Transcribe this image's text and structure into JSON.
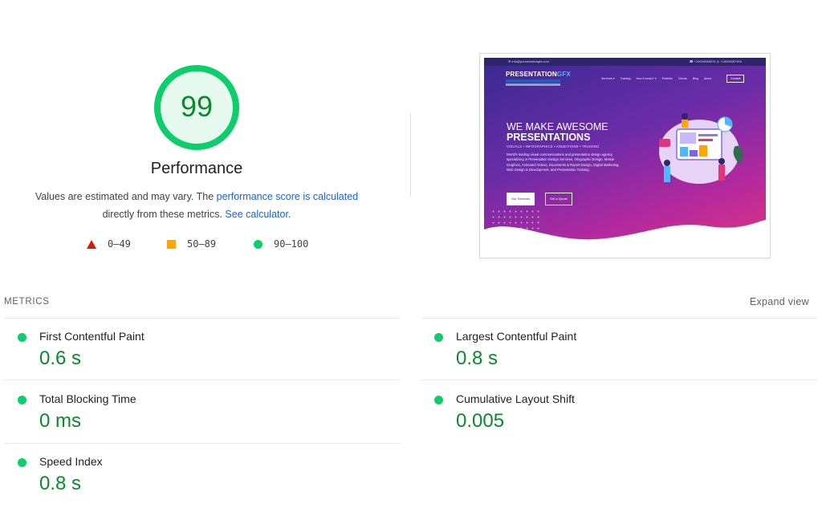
{
  "gauge": {
    "score": "99",
    "fraction": 0.99,
    "color": "#0cce6b"
  },
  "performance": {
    "title": "Performance",
    "desc_prefix": "Values are estimated and may vary. The ",
    "desc_link1": "performance score is calculated",
    "desc_middle": " directly from these metrics. ",
    "desc_link2": "See calculator."
  },
  "legend": [
    {
      "range": "0–49",
      "icon": "red-triangle-icon",
      "color": "#eb0f00"
    },
    {
      "range": "50–89",
      "icon": "orange-square-icon",
      "color": "#ffa400"
    },
    {
      "range": "90–100",
      "icon": "green-circle-icon",
      "color": "#0cce6b"
    }
  ],
  "screenshot": {
    "topbar_left": "✉ info@presentationgfx.com",
    "topbar_right": "☎ +19009088976  ◎ +19009087900",
    "logo_main": "PRESENTATION",
    "logo_accent": "GFX",
    "nav": [
      "Services ▾",
      "Training",
      "How it works? ▾",
      "Portfolio",
      "Clients",
      "Blog",
      "About"
    ],
    "contact": "Contact",
    "headline1": "WE MAKE AWESOME",
    "headline2": "PRESENTATIONS",
    "tagline": "VISUALS • INFOGRAPHICS • ANIMATIONS • TRAINING",
    "paragraph": "World's leading visual communications and presentation design agency specializing in Presentation Design Services, Infographic Design, Motion Graphics, Animated Videos, Documents & Report Design, Digital Marketing, Web Design & Development, and Presentation Training.",
    "btn_services": "Our Services",
    "btn_quote": "Get a Quote"
  },
  "metrics": {
    "header": "METRICS",
    "expand": "Expand view",
    "items": [
      {
        "title": "First Contentful Paint",
        "value": "0.6 s"
      },
      {
        "title": "Largest Contentful Paint",
        "value": "0.8 s"
      },
      {
        "title": "Total Blocking Time",
        "value": "0 ms"
      },
      {
        "title": "Cumulative Layout Shift",
        "value": "0.005"
      },
      {
        "title": "Speed Index",
        "value": "0.8 s"
      }
    ]
  }
}
